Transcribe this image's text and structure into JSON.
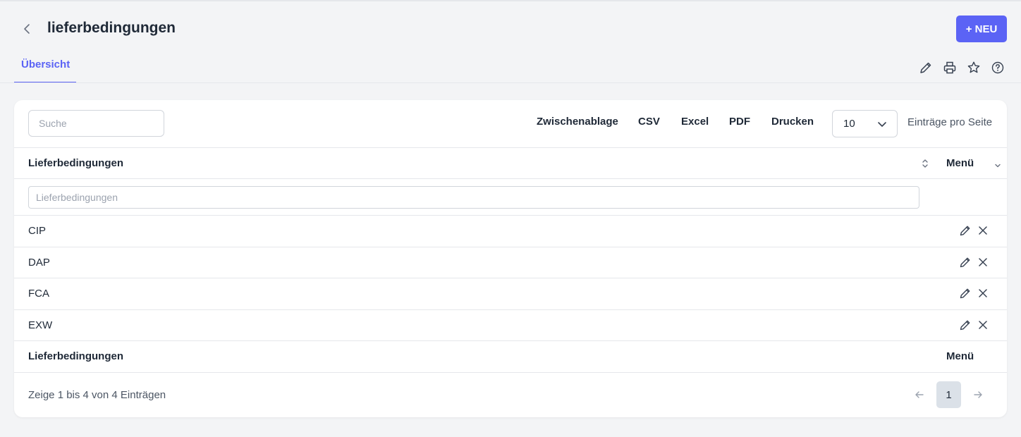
{
  "header": {
    "title": "lieferbedingungen",
    "new_button": "+ NEU"
  },
  "tabs": [
    {
      "label": "Übersicht",
      "active": true
    }
  ],
  "toolbar_icons": [
    "pencil-icon",
    "printer-icon",
    "star-icon",
    "help-circle-icon"
  ],
  "table_controls": {
    "search_placeholder": "Suche",
    "export_buttons": [
      "Zwischenablage",
      "CSV",
      "Excel",
      "PDF",
      "Drucken"
    ],
    "page_size": "10",
    "page_size_label": "Einträge pro Seite"
  },
  "table": {
    "columns": [
      "Lieferbedingungen",
      "Menü"
    ],
    "filter_placeholder": "Lieferbedingungen",
    "rows": [
      "CIP",
      "DAP",
      "FCA",
      "EXW"
    ],
    "footer_columns": [
      "Lieferbedingungen",
      "Menü"
    ]
  },
  "pagination": {
    "info": "Zeige 1 bis 4 von 4 Einträgen",
    "current_page": "1"
  },
  "colors": {
    "accent": "#5b63f5",
    "background": "#f3f4f6",
    "card": "#ffffff",
    "active_page": "#dbe1e8"
  }
}
